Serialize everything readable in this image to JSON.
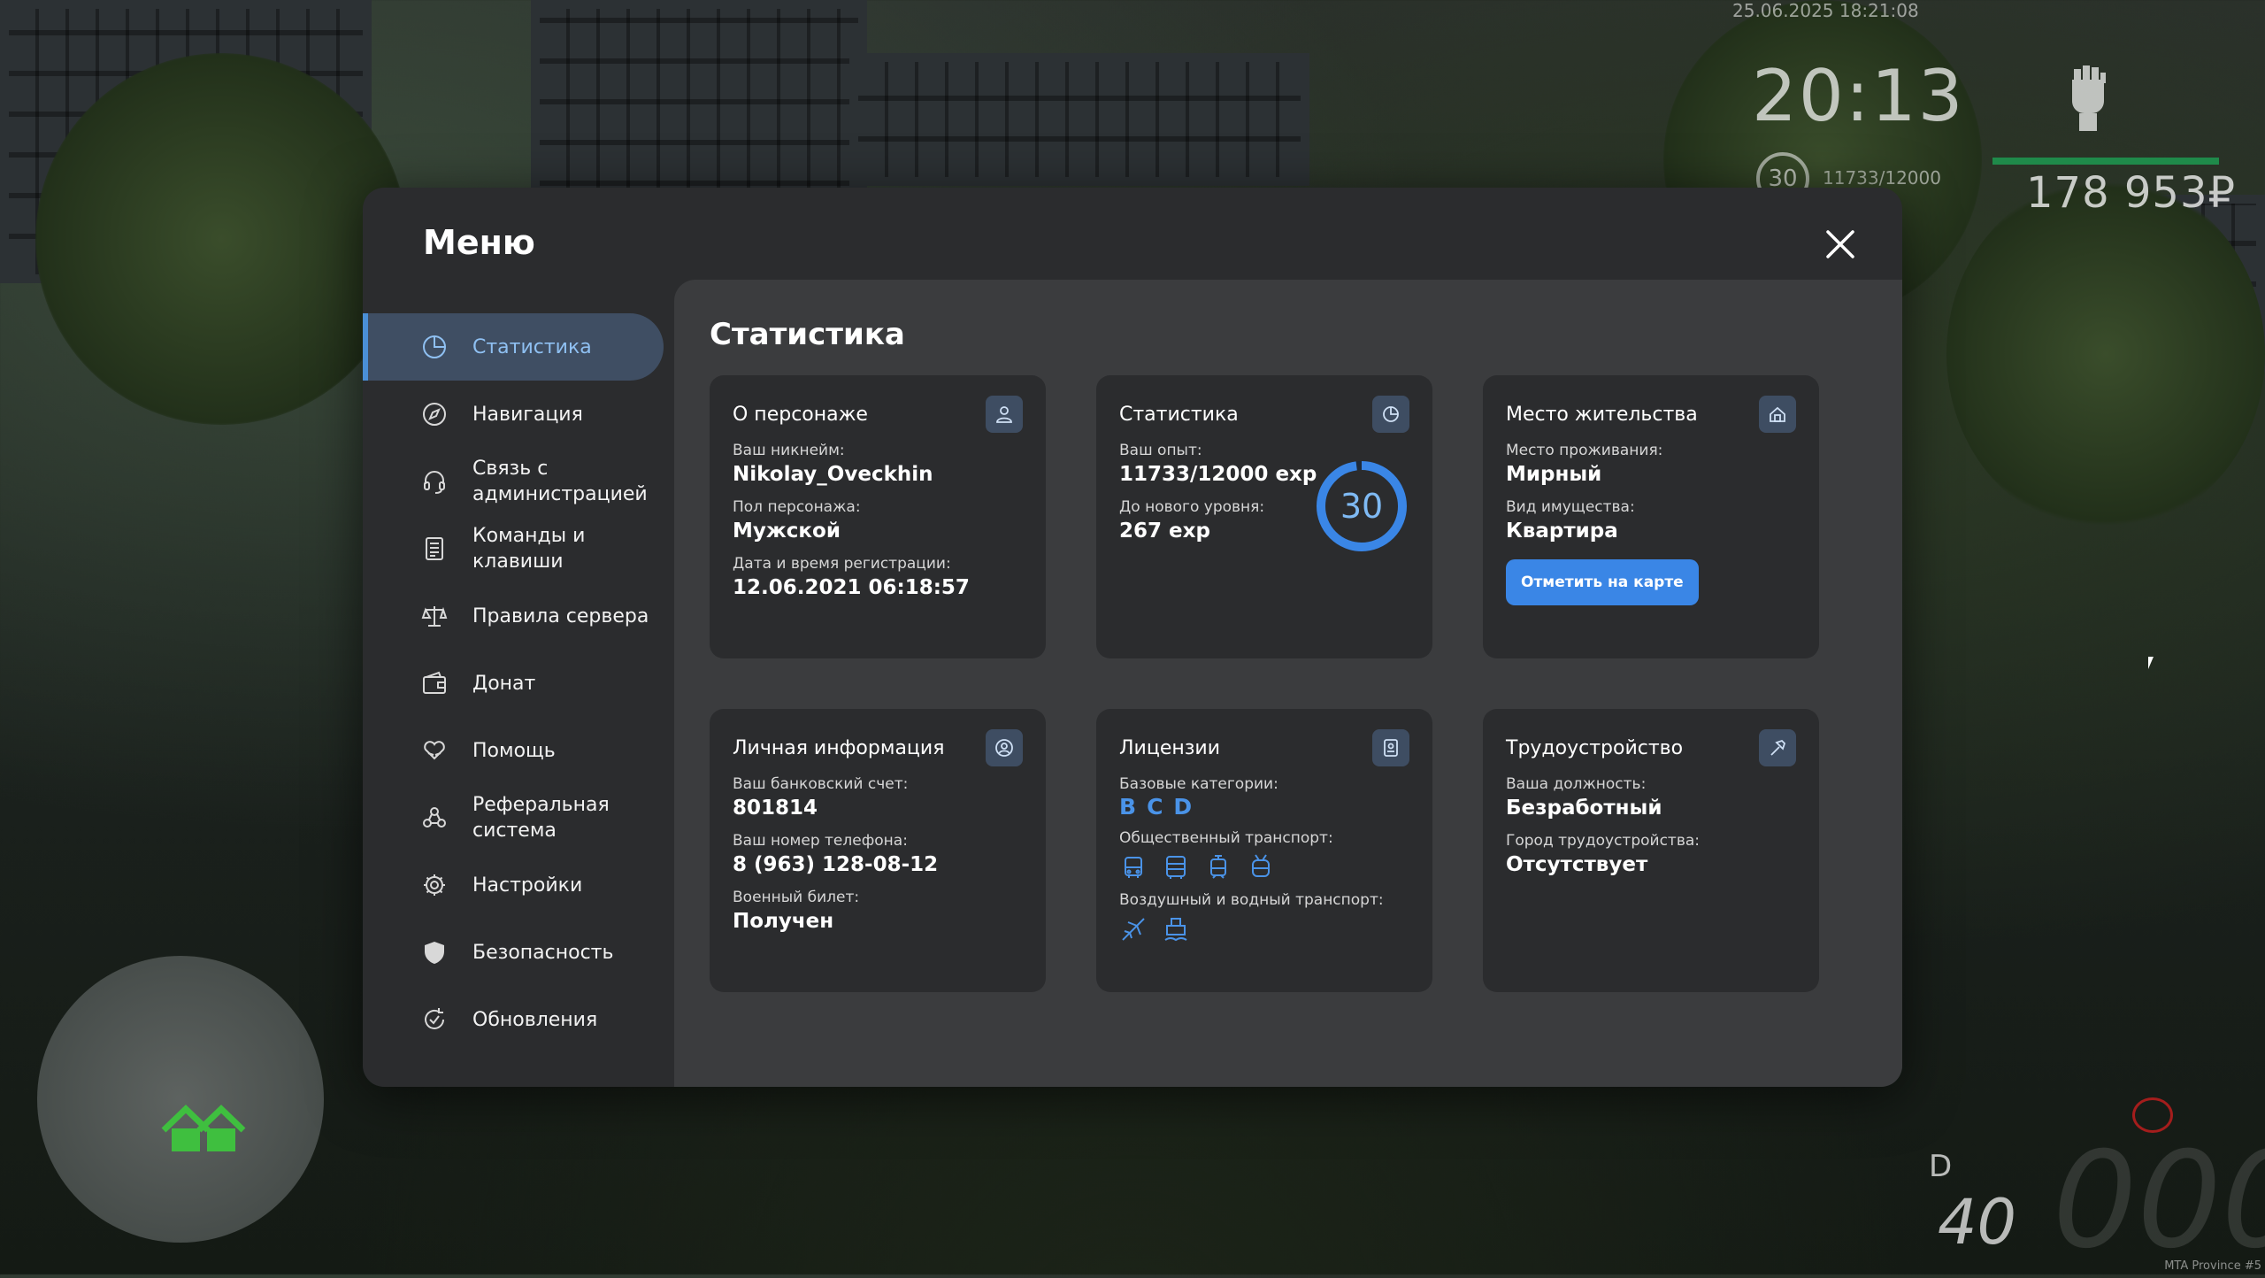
{
  "hud": {
    "datetime": "25.06.2025 18:21:08",
    "clock": "20:13",
    "level": "30",
    "exp": "11733/12000",
    "money": "178 953₽",
    "gear": "D",
    "fuel": "40",
    "watermark": "MTA Province #5"
  },
  "menu": {
    "title": "Меню",
    "items": [
      {
        "label": "Статистика",
        "icon": "pie-chart-icon"
      },
      {
        "label": "Навигация",
        "icon": "compass-icon"
      },
      {
        "label": "Связь с администрацией",
        "icon": "headset-icon"
      },
      {
        "label": "Команды и клавиши",
        "icon": "document-icon"
      },
      {
        "label": "Правила сервера",
        "icon": "scales-icon"
      },
      {
        "label": "Донат",
        "icon": "wallet-icon"
      },
      {
        "label": "Помощь",
        "icon": "heart-hands-icon"
      },
      {
        "label": "Реферальная система",
        "icon": "people-icon"
      },
      {
        "label": "Настройки",
        "icon": "gear-icon"
      },
      {
        "label": "Безопасность",
        "icon": "shield-icon"
      },
      {
        "label": "Обновления",
        "icon": "refresh-icon"
      }
    ]
  },
  "content": {
    "title": "Статистика",
    "character": {
      "title": "О персонаже",
      "nickname_label": "Ваш никнейм:",
      "nickname": "Nikolay_Oveckhin",
      "gender_label": "Пол персонажа:",
      "gender": "Мужской",
      "reg_label": "Дата и время регистрации:",
      "reg": "12.06.2021 06:18:57"
    },
    "stats": {
      "title": "Статистика",
      "exp_label": "Ваш опыт:",
      "exp": "11733/12000 exp",
      "next_label": "До нового уровня:",
      "next": "267 exp",
      "level": "30",
      "progress": 0.978
    },
    "residence": {
      "title": "Место жительства",
      "place_label": "Место проживания:",
      "place": "Мирный",
      "property_label": "Вид имущества:",
      "property": "Квартира",
      "button": "Отметить на карте"
    },
    "personal": {
      "title": "Личная информация",
      "bank_label": "Ваш банковский счет:",
      "bank": "801814",
      "phone_label": "Ваш номер телефона:",
      "phone": "8 (963) 128-08-12",
      "military_label": "Военный билет:",
      "military": "Получен"
    },
    "licenses": {
      "title": "Лицензии",
      "base_label": "Базовые категории:",
      "base": [
        "B",
        "C",
        "D"
      ],
      "public_label": "Общественный транспорт:",
      "public_icons": [
        "bus-icon",
        "bus-front-icon",
        "tram-icon",
        "trolleybus-icon"
      ],
      "air_label": "Воздушный и водный транспорт:",
      "air_icons": [
        "plane-icon",
        "boat-icon"
      ]
    },
    "employment": {
      "title": "Трудоустройство",
      "position_label": "Ваша должность:",
      "position": "Безработный",
      "city_label": "Город трудоустройства:",
      "city": "Отсутствует"
    }
  },
  "colors": {
    "accent": "#3a86e6",
    "card": "#2b2c2e",
    "panel": "#3b3c3e",
    "active_nav": "#3f4e63"
  }
}
